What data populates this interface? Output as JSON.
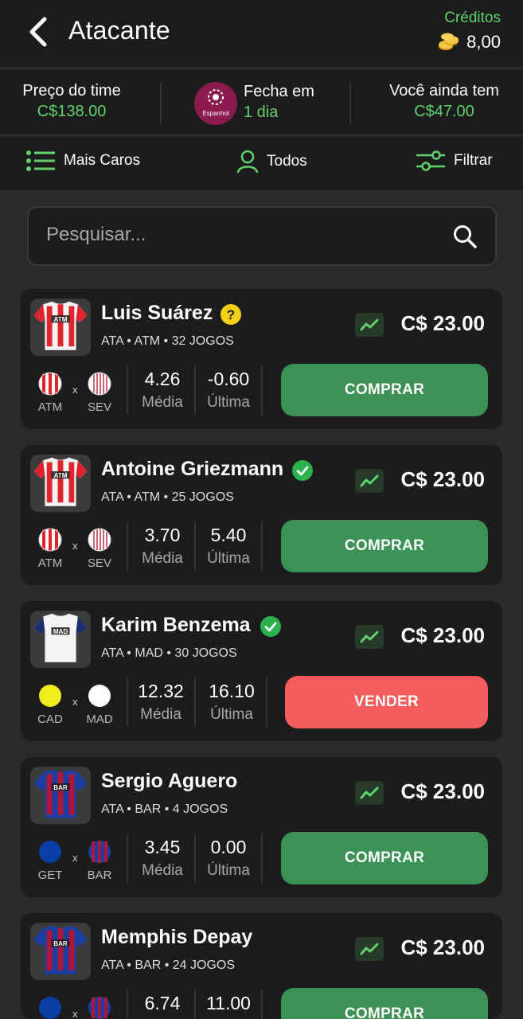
{
  "header": {
    "title": "Atacante",
    "credits_label": "Créditos",
    "credits_value": "8,00"
  },
  "stats": {
    "team_price_label": "Preço do time",
    "team_price_value": "C$138.00",
    "league_badge_text": "Espanhol",
    "closes_label": "Fecha em",
    "closes_value": "1 dia",
    "remaining_label": "Você ainda tem",
    "remaining_value": "C$47.00"
  },
  "toolbar": {
    "sort_label": "Mais Caros",
    "all_label": "Todos",
    "filter_label": "Filtrar"
  },
  "search": {
    "placeholder": "Pesquisar..."
  },
  "colors": {
    "accent_green": "#5ed36a",
    "buy_button": "#3c9255",
    "sell_button": "#f75c5c"
  },
  "players": [
    {
      "name": "Luis Suárez",
      "status_icon": "question-icon",
      "position": "ATA",
      "club": "ATM",
      "games": "32 JOGOS",
      "price": "C$ 23.00",
      "home_team": "ATM",
      "away_team": "SEV",
      "average": "4.26",
      "average_label": "Média",
      "last": "-0.60",
      "last_label": "Última",
      "action": "COMPRAR",
      "jersey": "ATM"
    },
    {
      "name": "Antoine Griezmann",
      "status_icon": "check-icon",
      "position": "ATA",
      "club": "ATM",
      "games": "25 JOGOS",
      "price": "C$ 23.00",
      "home_team": "ATM",
      "away_team": "SEV",
      "average": "3.70",
      "average_label": "Média",
      "last": "5.40",
      "last_label": "Última",
      "action": "COMPRAR",
      "jersey": "ATM"
    },
    {
      "name": "Karim Benzema",
      "status_icon": "check-icon",
      "position": "ATA",
      "club": "MAD",
      "games": "30 JOGOS",
      "price": "C$ 23.00",
      "home_team": "CAD",
      "away_team": "MAD",
      "average": "12.32",
      "average_label": "Média",
      "last": "16.10",
      "last_label": "Última",
      "action": "VENDER",
      "jersey": "MAD"
    },
    {
      "name": "Sergio Aguero",
      "status_icon": "",
      "position": "ATA",
      "club": "BAR",
      "games": "4 JOGOS",
      "price": "C$ 23.00",
      "home_team": "GET",
      "away_team": "BAR",
      "average": "3.45",
      "average_label": "Média",
      "last": "0.00",
      "last_label": "Última",
      "action": "COMPRAR",
      "jersey": "BAR"
    },
    {
      "name": "Memphis Depay",
      "status_icon": "",
      "position": "ATA",
      "club": "BAR",
      "games": "24 JOGOS",
      "price": "C$ 23.00",
      "home_team": "",
      "away_team": "",
      "average": "6.74",
      "average_label": "",
      "last": "11.00",
      "last_label": "",
      "action": "COMPRAR",
      "jersey": "BAR"
    }
  ]
}
